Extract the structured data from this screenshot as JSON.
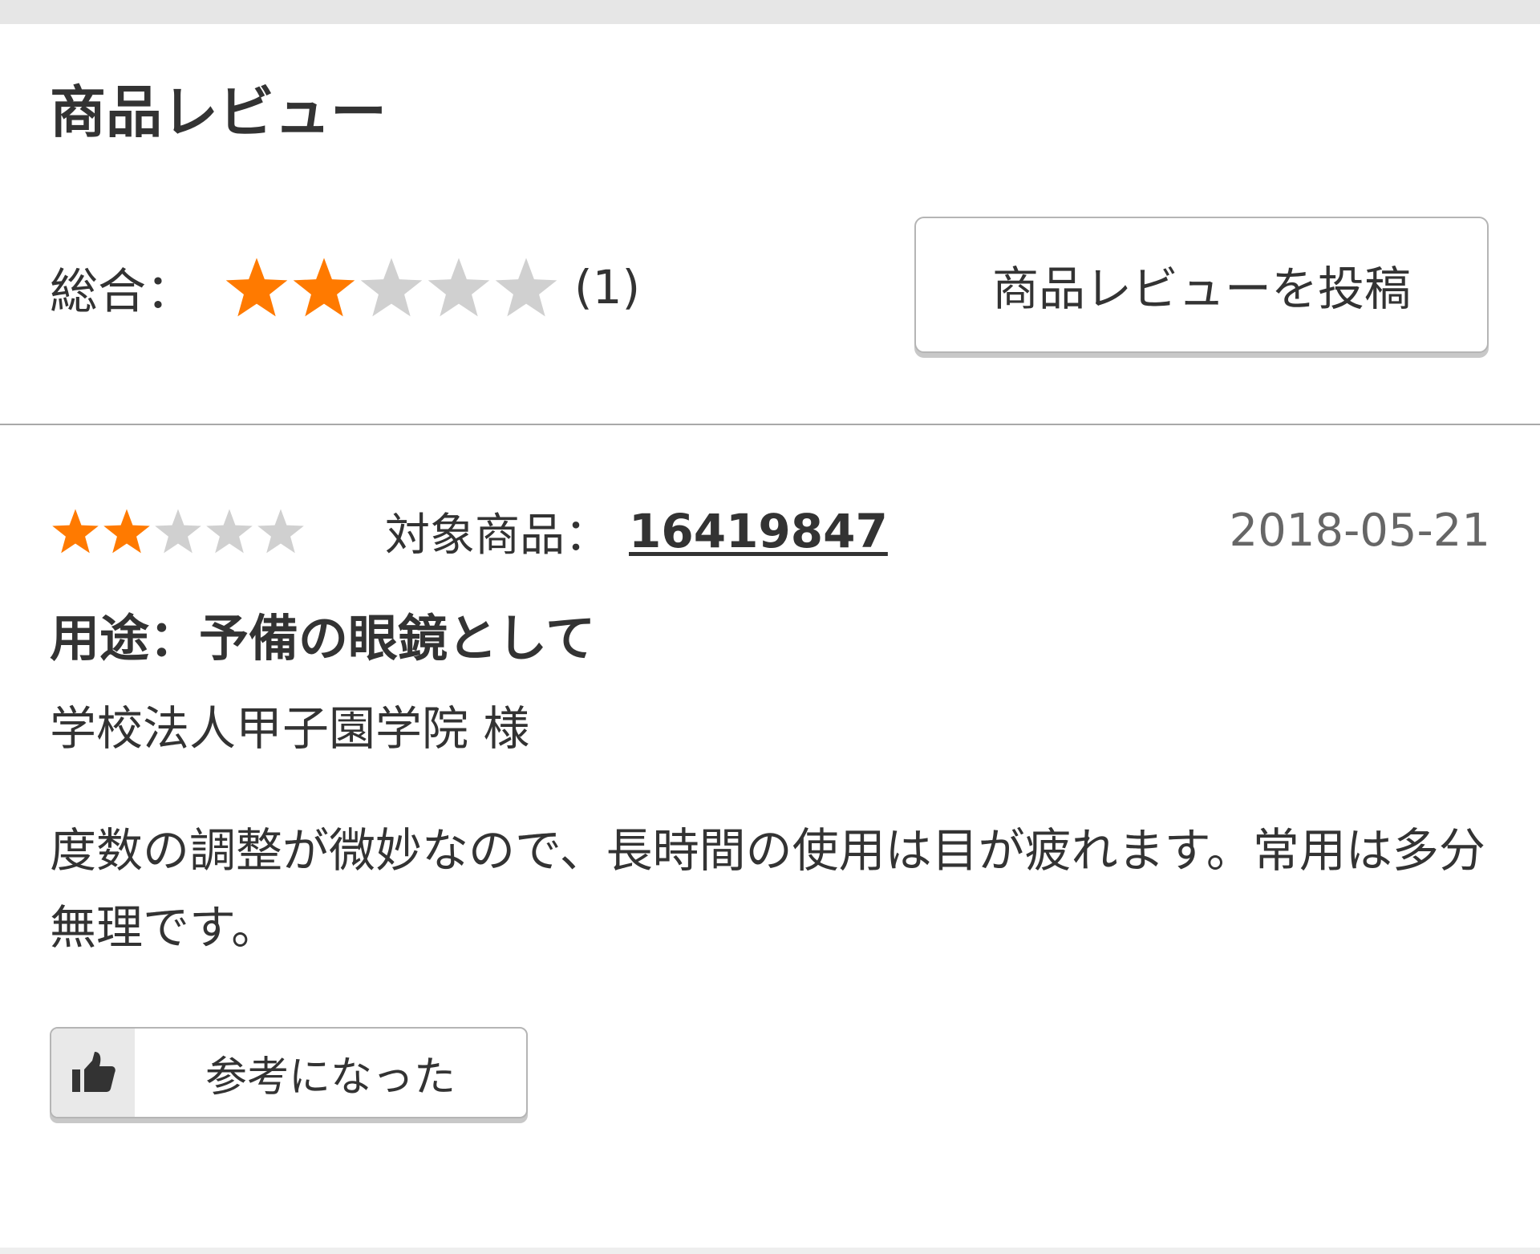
{
  "header": {
    "title": "商品レビュー"
  },
  "summary": {
    "label": "総合：",
    "rating": 2,
    "max_rating": 5,
    "count_text": "(1)",
    "post_button_label": "商品レビューを投稿"
  },
  "review": {
    "rating": 2,
    "max_rating": 5,
    "target_label": "対象商品：",
    "product_code": "16419847",
    "date": "2018-05-21",
    "usage": "用途：予備の眼鏡として",
    "reviewer": "学校法人甲子園学院 様",
    "body": "度数の調整が微妙なので、長時間の使用は目が疲れます。常用は多分無理です。",
    "helpful_button_label": "参考になった",
    "helpful_icon": "thumbs-up-icon"
  },
  "colors": {
    "star_filled": "#ff7a00",
    "star_empty": "#d0d0d0",
    "text": "#333333",
    "date_text": "#666666"
  }
}
